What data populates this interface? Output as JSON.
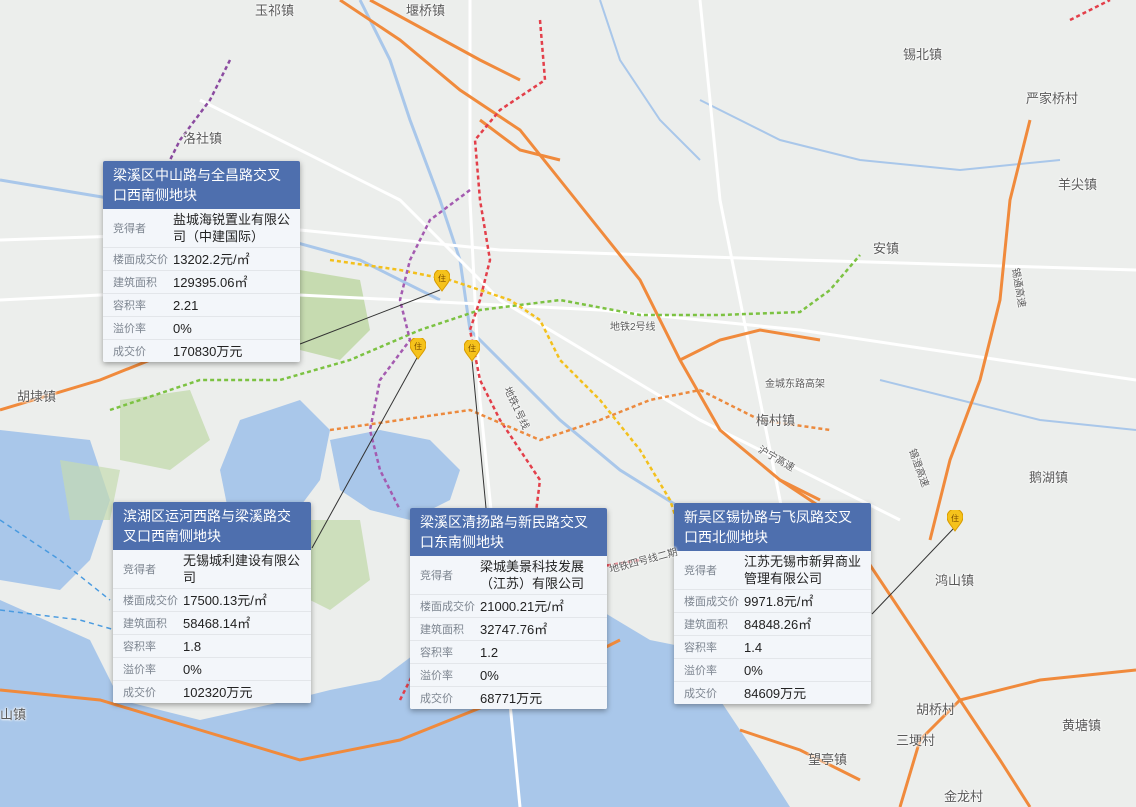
{
  "place_labels": [
    {
      "id": "yuqi",
      "text": "玉祁镇"
    },
    {
      "id": "yanqiao",
      "text": "堰桥镇"
    },
    {
      "id": "xibei",
      "text": "锡北镇"
    },
    {
      "id": "luoshe",
      "text": "洛社镇"
    },
    {
      "id": "yanjiaqiao",
      "text": "严家桥村"
    },
    {
      "id": "yangjian",
      "text": "羊尖镇"
    },
    {
      "id": "anzhen",
      "text": "安镇"
    },
    {
      "id": "hudai",
      "text": "胡埭镇"
    },
    {
      "id": "meicun",
      "text": "梅村镇"
    },
    {
      "id": "ehu",
      "text": "鹅湖镇"
    },
    {
      "id": "hongshan",
      "text": "鸿山镇"
    },
    {
      "id": "shan",
      "text": "山镇"
    },
    {
      "id": "huqiao",
      "text": "胡桥村"
    },
    {
      "id": "huangtang",
      "text": "黄塘镇"
    },
    {
      "id": "santang",
      "text": "三埂村"
    },
    {
      "id": "wangting",
      "text": "望亭镇"
    },
    {
      "id": "jinlong",
      "text": "金龙村"
    }
  ],
  "road_labels": [
    "沪宁高速",
    "锡澄高速",
    "地铁2号线",
    "地铁1号线",
    "地铁四号线二期",
    "金城东路高架",
    "锡通高速"
  ],
  "cards": [
    {
      "title": "梁溪区中山路与全昌路交叉口西南侧地块",
      "rows": [
        {
          "k": "竞得者",
          "v": "盐城海锐置业有限公司（中建国际）"
        },
        {
          "k": "楼面成交价",
          "v": "13202.2元/㎡"
        },
        {
          "k": "建筑面积",
          "v": "129395.06㎡"
        },
        {
          "k": "容积率",
          "v": "2.21"
        },
        {
          "k": "溢价率",
          "v": "0%"
        },
        {
          "k": "成交价",
          "v": "170830万元"
        }
      ]
    },
    {
      "title": "滨湖区运河西路与梁溪路交叉口西南侧地块",
      "rows": [
        {
          "k": "竞得者",
          "v": "无锡城利建设有限公司"
        },
        {
          "k": "楼面成交价",
          "v": "17500.13元/㎡"
        },
        {
          "k": "建筑面积",
          "v": "58468.14㎡"
        },
        {
          "k": "容积率",
          "v": "1.8"
        },
        {
          "k": "溢价率",
          "v": "0%"
        },
        {
          "k": "成交价",
          "v": "102320万元"
        }
      ]
    },
    {
      "title": "梁溪区清扬路与新民路交叉口东南侧地块",
      "rows": [
        {
          "k": "竞得者",
          "v": "梁城美景科技发展（江苏）有限公司"
        },
        {
          "k": "楼面成交价",
          "v": "21000.21元/㎡"
        },
        {
          "k": "建筑面积",
          "v": "32747.76㎡"
        },
        {
          "k": "容积率",
          "v": "1.2"
        },
        {
          "k": "溢价率",
          "v": "0%"
        },
        {
          "k": "成交价",
          "v": "68771万元"
        }
      ]
    },
    {
      "title": "新吴区锡协路与飞凤路交叉口西北侧地块",
      "rows": [
        {
          "k": "竞得者",
          "v": "江苏无锡市新昇商业管理有限公司"
        },
        {
          "k": "楼面成交价",
          "v": "9971.8元/㎡"
        },
        {
          "k": "建筑面积",
          "v": "84848.26㎡"
        },
        {
          "k": "容积率",
          "v": "1.4"
        },
        {
          "k": "溢价率",
          "v": "0%"
        },
        {
          "k": "成交价",
          "v": "84609万元"
        }
      ]
    }
  ],
  "pin_label": "住",
  "colors": {
    "card_header": "#4e6fae",
    "highway": "#f08a3c",
    "water": "#a9c7ea",
    "green": "#c6dbb0",
    "pin": "#f5c21b"
  }
}
